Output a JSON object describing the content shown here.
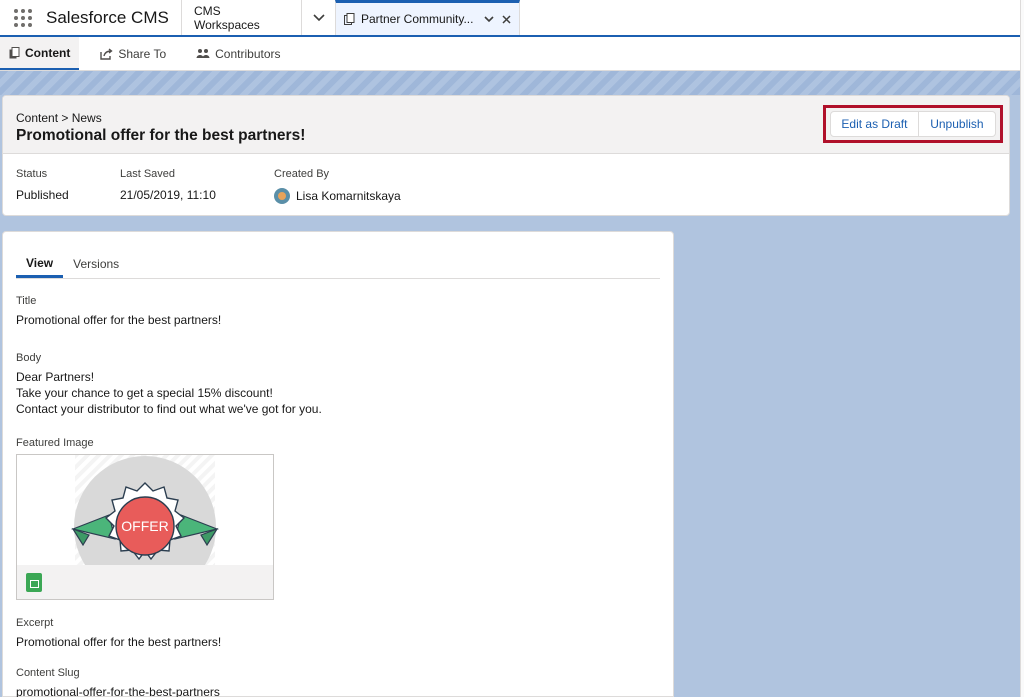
{
  "app": {
    "name": "Salesforce CMS"
  },
  "nav_tabs": [
    {
      "label": "CMS Workspaces"
    },
    {
      "label": "Partner Community..."
    }
  ],
  "sub_tabs": [
    {
      "label": "Content",
      "icon": "content-icon"
    },
    {
      "label": "Share To",
      "icon": "share-icon"
    },
    {
      "label": "Contributors",
      "icon": "contributors-icon"
    }
  ],
  "header": {
    "breadcrumb": "Content > News",
    "title": "Promotional offer for the best partners!",
    "actions": {
      "edit_draft": "Edit as Draft",
      "unpublish": "Unpublish"
    },
    "meta": {
      "status_label": "Status",
      "status_value": "Published",
      "saved_label": "Last Saved",
      "saved_value": "21/05/2019, 11:10",
      "created_label": "Created By",
      "created_value": "Lisa Komarnitskaya"
    }
  },
  "content": {
    "tabs": [
      {
        "label": "View"
      },
      {
        "label": "Versions"
      }
    ],
    "fields": {
      "title_label": "Title",
      "title_value": "Promotional offer for the best partners!",
      "body_label": "Body",
      "body_line1": "Dear Partners!",
      "body_line2": "Take your chance to get a special 15% discount!",
      "body_line3": "Contact your distributor to find out what we've got for you.",
      "image_label": "Featured Image",
      "image_badge_text": "OFFER",
      "excerpt_label": "Excerpt",
      "excerpt_value": "Promotional offer for the best partners!",
      "slug_label": "Content Slug",
      "slug_value": "promotional-offer-for-the-best-partners"
    }
  },
  "colors": {
    "brand": "#1b5fb1",
    "highlight_box": "#b0102a",
    "background": "#b0c4df",
    "offer_red": "#e85c5a",
    "ribbon_green": "#4bb57a"
  }
}
